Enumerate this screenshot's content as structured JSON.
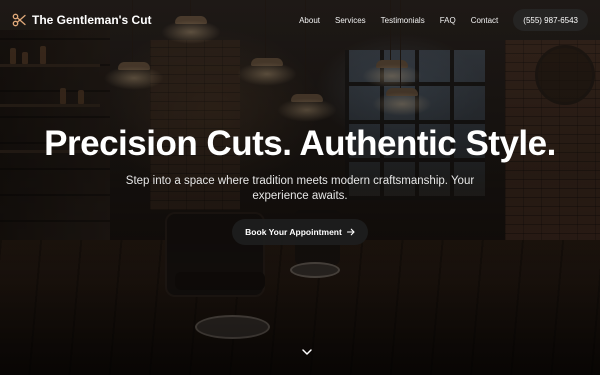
{
  "brand": {
    "name": "The Gentleman's Cut",
    "icon": "scissors-icon",
    "accent": "#e0a97a"
  },
  "nav": {
    "links": [
      "About",
      "Services",
      "Testimonials",
      "FAQ",
      "Contact"
    ],
    "phone": "(555) 987-6543"
  },
  "hero": {
    "headline": "Precision Cuts. Authentic Style.",
    "subtext": "Step into a space where tradition meets modern craftsmanship. Your experience awaits.",
    "cta_label": "Book Your Appointment",
    "cta_icon": "arrow-right-icon",
    "scroll_icon": "chevron-down-icon"
  }
}
